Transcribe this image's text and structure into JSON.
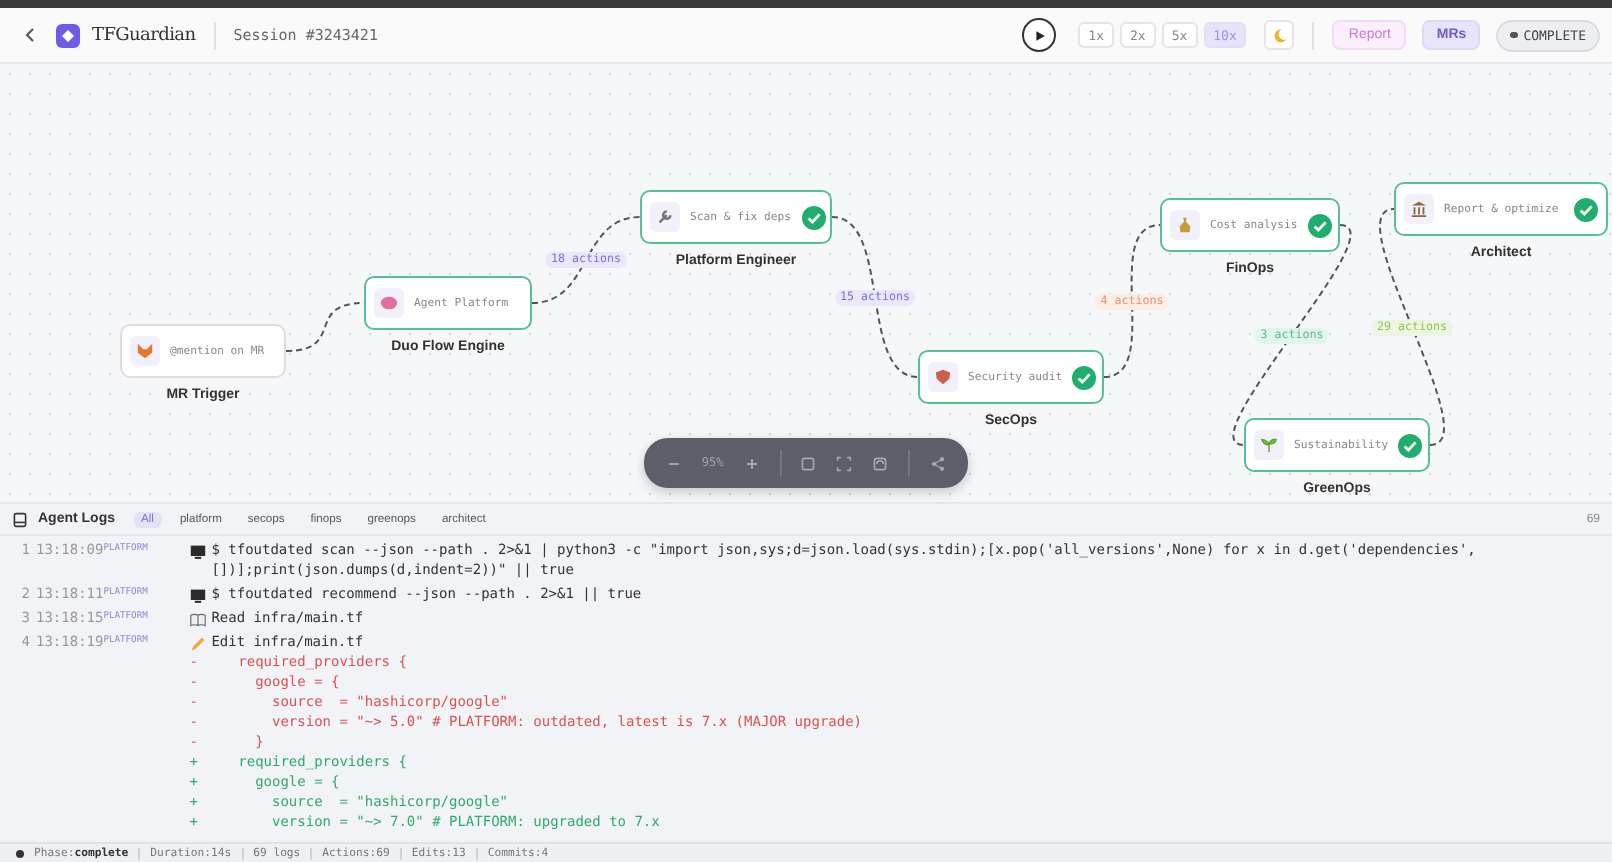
{
  "header": {
    "title": "TFGuardian",
    "session": "Session #3243421",
    "speeds": [
      {
        "label": "1x",
        "selected": false
      },
      {
        "label": "2x",
        "selected": false
      },
      {
        "label": "5x",
        "selected": false
      },
      {
        "label": "10x",
        "selected": true
      }
    ],
    "report": "Report",
    "mrs": "MRs",
    "status": "COMPLETE"
  },
  "flow": {
    "nodes": [
      {
        "title": "@mention on MR",
        "label": "MR Trigger",
        "highlighted": false,
        "checked": false
      },
      {
        "title": "Agent Platform",
        "label": "Duo Flow Engine",
        "highlighted": true,
        "checked": false
      },
      {
        "title": "Scan & fix deps",
        "label": "Platform Engineer",
        "highlighted": true,
        "checked": true,
        "incoming": {
          "label": "18 actions",
          "color": "#7c6fe0"
        }
      },
      {
        "title": "Security audit",
        "label": "SecOps",
        "highlighted": true,
        "checked": true,
        "incoming": {
          "label": "15 actions",
          "color": "#7c6fe0"
        }
      },
      {
        "title": "Cost analysis",
        "label": "FinOps",
        "highlighted": true,
        "checked": true,
        "incoming": {
          "label": "4 actions",
          "color": "#e8956a"
        }
      },
      {
        "title": "Sustainability",
        "label": "GreenOps",
        "highlighted": true,
        "checked": true,
        "incoming": {
          "label": "3 actions",
          "color": "#4fbf8a"
        }
      },
      {
        "title": "Report & optimize",
        "label": "Architect",
        "highlighted": true,
        "checked": true,
        "incoming": {
          "label": "29 actions",
          "color": "#8fc44f"
        }
      }
    ],
    "zoom_text": "95%"
  },
  "logs": {
    "title": "Agent Logs",
    "count": "69",
    "filters": [
      {
        "label": "All",
        "selected": true
      },
      {
        "label": "platform",
        "selected": false
      },
      {
        "label": "secops",
        "selected": false
      },
      {
        "label": "finops",
        "selected": false
      },
      {
        "label": "greenops",
        "selected": false
      },
      {
        "label": "architect",
        "selected": false
      }
    ],
    "entries": [
      {
        "number": "1",
        "time": "13:18:09",
        "source": "PLATFORM",
        "kind": "command",
        "text": "$ tfoutdated scan --json --path . 2>&1 | python3 -c \"import json,sys;d=json.load(sys.stdin);[x.pop('all_versions',None) for x in d.get('dependencies', [])];print(json.dumps(d,indent=2))\" || true"
      },
      {
        "number": "2",
        "time": "13:18:11",
        "source": "PLATFORM",
        "kind": "command",
        "text": "$ tfoutdated recommend --json --path . 2>&1 || true"
      },
      {
        "number": "3",
        "time": "13:18:15",
        "source": "PLATFORM",
        "kind": "read",
        "text": "Read infra/main.tf"
      },
      {
        "number": "4",
        "time": "13:18:19",
        "source": "PLATFORM",
        "kind": "edit",
        "text": "Edit infra/main.tf",
        "diff": [
          {
            "kind": "removed",
            "marker": "-",
            "text": "  required_providers {"
          },
          {
            "kind": "removed",
            "marker": "-",
            "text": "    google = {"
          },
          {
            "kind": "removed",
            "marker": "-",
            "text": "      source  = \"hashicorp/google\""
          },
          {
            "kind": "removed",
            "marker": "-",
            "text": "      version = \"~> 5.0\" # PLATFORM: outdated, latest is 7.x (MAJOR upgrade)"
          },
          {
            "kind": "removed",
            "marker": "-",
            "text": "    }"
          },
          {
            "kind": "added",
            "marker": "+",
            "text": "  required_providers {"
          },
          {
            "kind": "added",
            "marker": "+",
            "text": "    google = {"
          },
          {
            "kind": "added",
            "marker": "+",
            "text": "      source  = \"hashicorp/google\""
          },
          {
            "kind": "added",
            "marker": "+",
            "text": "      version = \"~> 7.0\" # PLATFORM: upgraded to 7.x"
          }
        ]
      }
    ]
  },
  "status_bar": [
    {
      "key": "Phase:",
      "value": "complete"
    },
    {
      "key": "Duration:",
      "value": "14s"
    },
    {
      "value": "69 logs"
    },
    {
      "key": "Actions:",
      "value": "69"
    },
    {
      "key": "Edits:",
      "value": "13"
    },
    {
      "key": "Commits:",
      "value": "4"
    }
  ]
}
